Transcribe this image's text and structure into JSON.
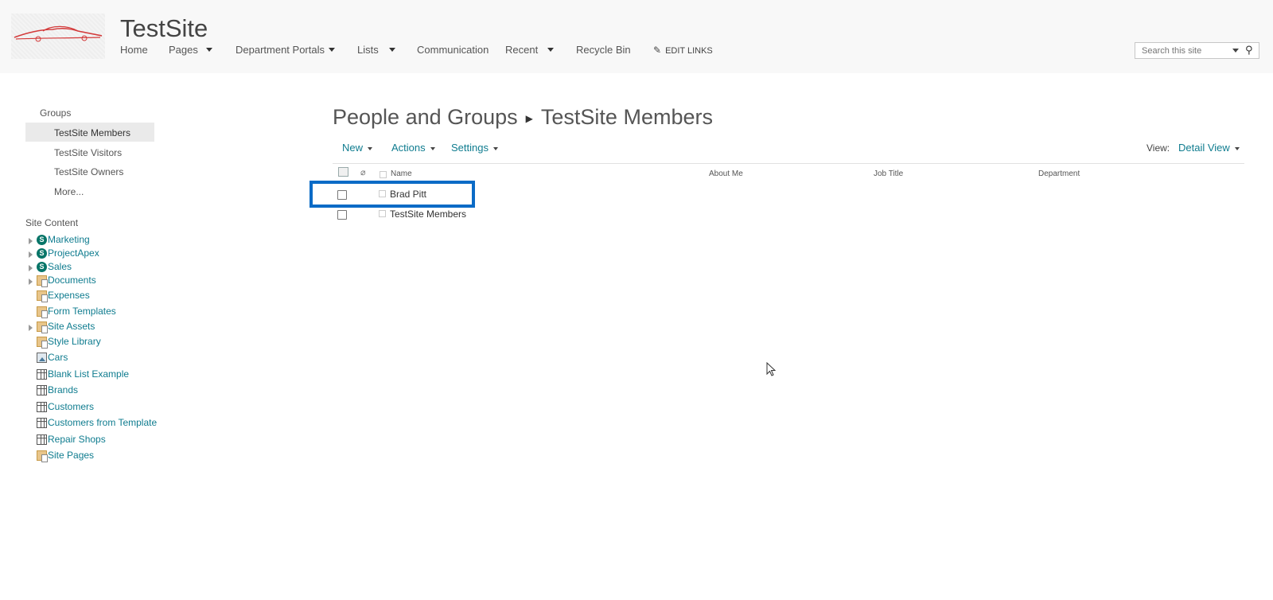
{
  "header": {
    "site_title": "TestSite",
    "nav": [
      {
        "label": "Home",
        "has_dropdown": false
      },
      {
        "label": "Pages",
        "has_dropdown": true
      },
      {
        "label": "Department Portals",
        "has_dropdown": true
      },
      {
        "label": "Lists",
        "has_dropdown": true
      },
      {
        "label": "Communication",
        "has_dropdown": false
      },
      {
        "label": "Recent",
        "has_dropdown": true
      },
      {
        "label": "Recycle Bin",
        "has_dropdown": false
      }
    ],
    "edit_links": "EDIT LINKS",
    "search_placeholder": "Search this site"
  },
  "leftnav": {
    "groups_heading": "Groups",
    "groups": [
      "TestSite Members",
      "TestSite Visitors",
      "TestSite Owners",
      "More..."
    ],
    "site_content_heading": "Site Content",
    "site_content": [
      {
        "label": "Marketing",
        "icon": "subsite-icon",
        "expandable": true
      },
      {
        "label": "ProjectApex",
        "icon": "subsite-icon",
        "expandable": true
      },
      {
        "label": "Sales",
        "icon": "subsite-icon",
        "expandable": true
      },
      {
        "label": "Documents",
        "icon": "document-library-icon",
        "expandable": true
      },
      {
        "label": "Expenses",
        "icon": "document-library-icon",
        "expandable": false
      },
      {
        "label": "Form Templates",
        "icon": "document-library-icon",
        "expandable": false
      },
      {
        "label": "Site Assets",
        "icon": "document-library-icon",
        "expandable": true
      },
      {
        "label": "Style Library",
        "icon": "document-library-icon",
        "expandable": false
      },
      {
        "label": "Cars",
        "icon": "picture-library-icon",
        "expandable": false
      },
      {
        "label": "Blank List Example",
        "icon": "list-icon",
        "expandable": false
      },
      {
        "label": "Brands",
        "icon": "list-icon",
        "expandable": false
      },
      {
        "label": "Customers",
        "icon": "list-icon",
        "expandable": false
      },
      {
        "label": "Customers from Template",
        "icon": "list-icon",
        "expandable": false
      },
      {
        "label": "Repair Shops",
        "icon": "list-icon",
        "expandable": false
      },
      {
        "label": "Site Pages",
        "icon": "document-library-icon",
        "expandable": false
      }
    ]
  },
  "main": {
    "breadcrumb_root": "People and Groups",
    "breadcrumb_current": "TestSite Members",
    "toolbar": {
      "new": "New",
      "actions": "Actions",
      "settings": "Settings"
    },
    "view_label": "View:",
    "view_value": "Detail View",
    "columns": [
      "Name",
      "About Me",
      "Job Title",
      "Department"
    ],
    "rows": [
      {
        "name": "Brad Pitt"
      },
      {
        "name": "TestSite Members"
      }
    ]
  },
  "colors": {
    "accent_link": "#0f7c8f",
    "highlight_border": "#0b6bc6",
    "sharepoint_teal": "#077568"
  }
}
